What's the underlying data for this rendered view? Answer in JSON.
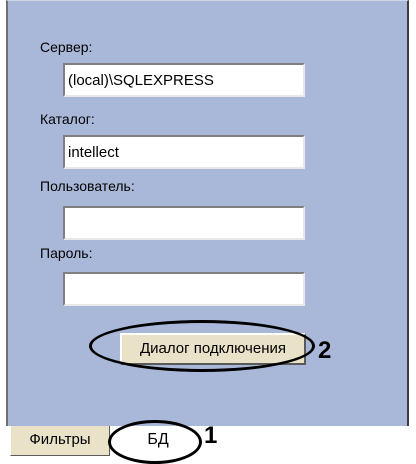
{
  "connection": {
    "server_label": "Сервер:",
    "server_value": "(local)\\SQLEXPRESS",
    "catalog_label": "Каталог:",
    "catalog_value": "intellect",
    "user_label": "Пользователь:",
    "user_value": "",
    "password_label": "Пароль:",
    "password_value": ""
  },
  "buttons": {
    "connect_dialog": "Диалог подключения"
  },
  "tabs": [
    {
      "label": "Фильтры",
      "active": false
    },
    {
      "label": "БД",
      "active": true
    }
  ],
  "callouts": {
    "db_tab": "1",
    "connect_button": "2"
  },
  "colors": {
    "panel_bg": "#a9b8d8",
    "button_bg": "#e9e1c8"
  }
}
